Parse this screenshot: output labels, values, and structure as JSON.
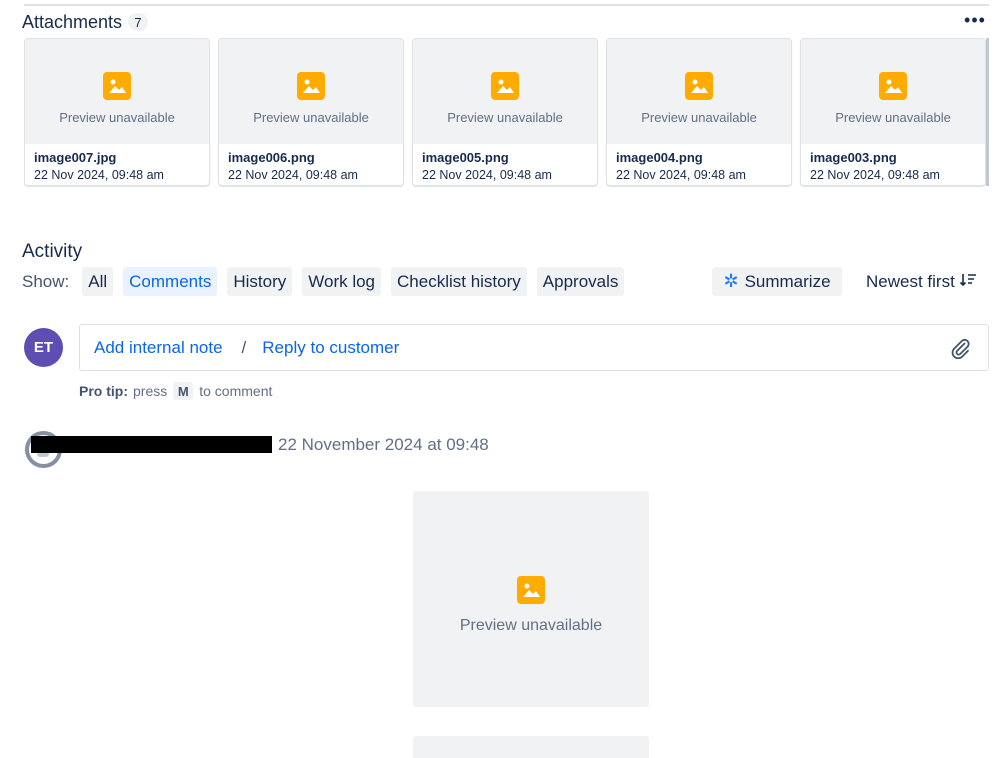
{
  "attachments": {
    "title": "Attachments",
    "count": "7",
    "more_label": "•••",
    "preview_text": "Preview unavailable",
    "items": [
      {
        "name": "image007.jpg",
        "date": "22 Nov 2024, 09:48 am"
      },
      {
        "name": "image006.png",
        "date": "22 Nov 2024, 09:48 am"
      },
      {
        "name": "image005.png",
        "date": "22 Nov 2024, 09:48 am"
      },
      {
        "name": "image004.png",
        "date": "22 Nov 2024, 09:48 am"
      },
      {
        "name": "image003.png",
        "date": "22 Nov 2024, 09:48 am"
      }
    ]
  },
  "activity": {
    "title": "Activity",
    "show_label": "Show:",
    "filters": [
      "All",
      "Comments",
      "History",
      "Work log",
      "Checklist history",
      "Approvals"
    ],
    "active_filter": "Comments",
    "summarize_label": "Summarize",
    "sort_label": "Newest first"
  },
  "composer": {
    "avatar_initials": "ET",
    "internal_note": "Add internal note",
    "separator": "/",
    "reply_customer": "Reply to customer",
    "protip_label": "Pro tip:",
    "protip_press": "press",
    "protip_key": "M",
    "protip_suffix": "to comment"
  },
  "entry": {
    "timestamp": "22 November 2024 at 09:48",
    "preview_text": "Preview unavailable"
  },
  "colors": {
    "accent_blue": "#0c66e4",
    "avatar_purple": "#5e4db2",
    "image_icon": "#ffab00"
  }
}
